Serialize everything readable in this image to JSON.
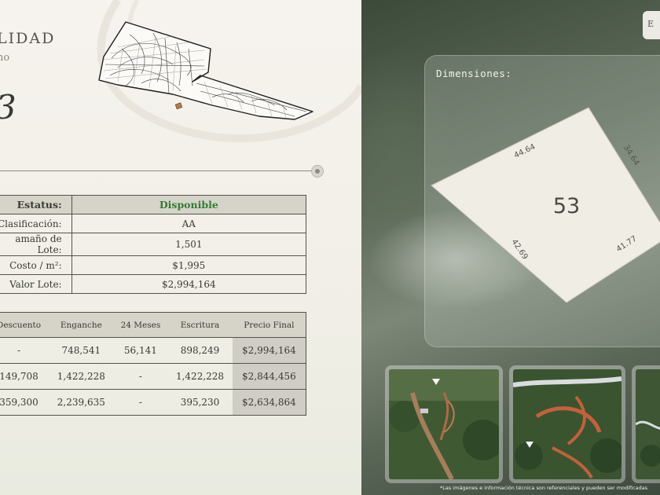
{
  "header": {
    "title": "LIDAD",
    "subtitle": "no",
    "lot_number_partial": "3"
  },
  "lot_info": {
    "rows": [
      {
        "key": "Estatus:",
        "value": "Disponible"
      },
      {
        "key": "Clasificación:",
        "value": "AA"
      },
      {
        "key": "amaño de Lote:",
        "value": "1,501"
      },
      {
        "key": "Costo / m²:",
        "value": "$1,995"
      },
      {
        "key": "Valor Lote:",
        "value": "$2,994,164"
      }
    ],
    "status_color": "#2e7d32"
  },
  "price_table": {
    "headers": [
      "Descuento",
      "Enganche",
      "24 Meses",
      "Escritura",
      "Precio Final"
    ],
    "rows": [
      [
        "-",
        "748,541",
        "56,141",
        "898,249",
        "$2,994,164"
      ],
      [
        "149,708",
        "1,422,228",
        "-",
        "1,422,228",
        "$2,844,456"
      ],
      [
        "359,300",
        "2,239,635",
        "-",
        "395,230",
        "$2,634,864"
      ]
    ]
  },
  "slider": {
    "value": 1.0
  },
  "dimensions": {
    "title": "Dimensiones:",
    "lot_number": "53",
    "sides": [
      "44.64",
      "34.64",
      "41.77",
      "42.69"
    ]
  },
  "top_button": {
    "label": "E"
  },
  "footnote": "*Las imágenes e información técnica son referenciales y pueden ser modificadas",
  "colors": {
    "panel_bg": "#f4f1eb",
    "table_header": "#d6d3c8",
    "lot_fill": "#f0ede4"
  }
}
